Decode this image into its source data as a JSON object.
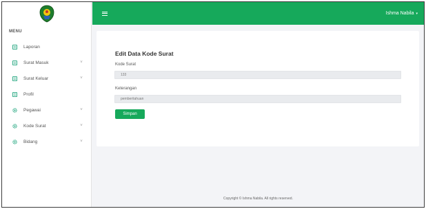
{
  "sidebar": {
    "menu_heading": "MENU",
    "items": [
      {
        "label": "Laporan",
        "icon": "file-icon",
        "has_submenu": false
      },
      {
        "label": "Surat Masuk",
        "icon": "file-icon",
        "has_submenu": true
      },
      {
        "label": "Surat Keluar",
        "icon": "file-icon",
        "has_submenu": true
      },
      {
        "label": "Profil",
        "icon": "file-icon",
        "has_submenu": false
      },
      {
        "label": "Pegawai",
        "icon": "gear-icon",
        "has_submenu": true
      },
      {
        "label": "Kode Surat",
        "icon": "gear-icon",
        "has_submenu": true
      },
      {
        "label": "Bidang",
        "icon": "gear-icon",
        "has_submenu": true
      }
    ],
    "chevron": "˅"
  },
  "topbar": {
    "user_name": "Ishma Nabila",
    "caret": "▾"
  },
  "form": {
    "title": "Edit Data Kode Surat",
    "kode_label": "Kode Surat",
    "kode_value": "133",
    "keterangan_label": "Keterangan",
    "keterangan_value": "pemberitahuan",
    "save_label": "Simpan"
  },
  "footer": {
    "text": "Copyright © Ishma Nabila. All rights reserved."
  },
  "colors": {
    "brand_green": "#16a95b",
    "icon_teal": "#1aa37a",
    "background": "#f3f4f7"
  }
}
